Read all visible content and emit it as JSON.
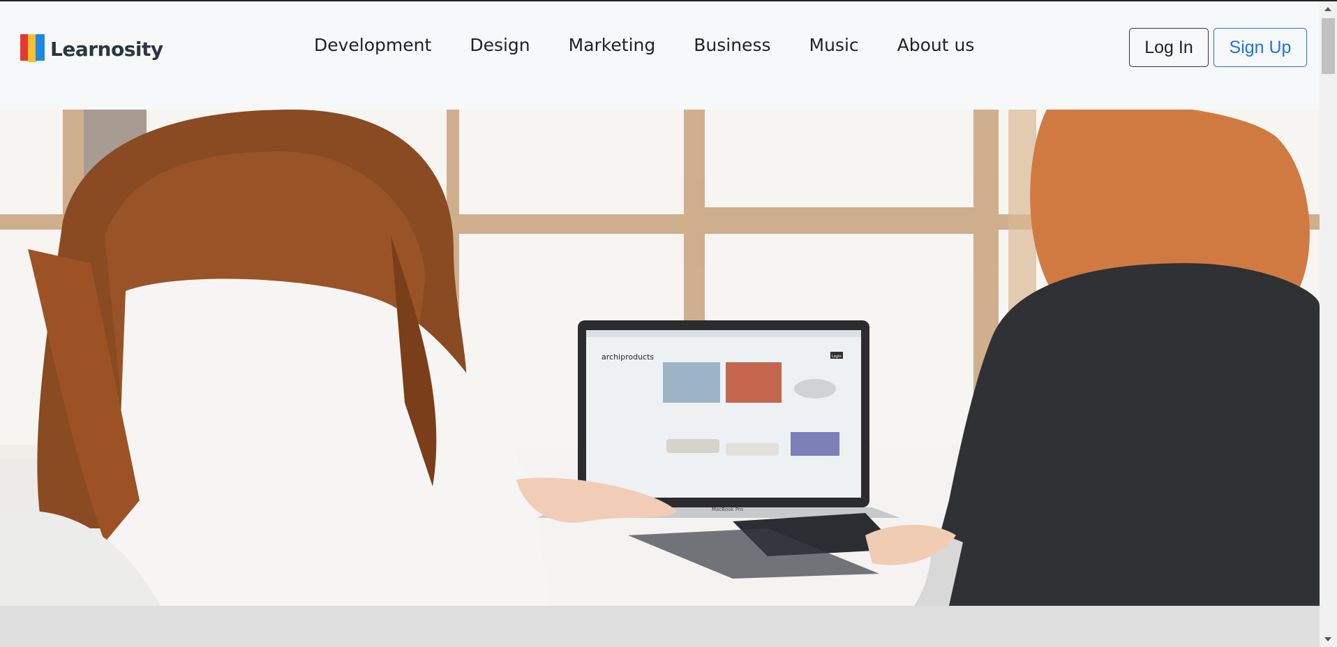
{
  "brand": {
    "name": "Learnosity",
    "colors": [
      "#e53935",
      "#fbc02d",
      "#1e88e5"
    ]
  },
  "nav": {
    "links": [
      "Development",
      "Design",
      "Marketing",
      "Business",
      "Music",
      "About us"
    ]
  },
  "auth": {
    "login_label": "Log In",
    "signup_label": "Sign Up",
    "signup_color": "#1a73e8"
  },
  "hero": {
    "icon": "hero-photo",
    "laptop_screen_title": "archiproducts",
    "laptop_screen_button": "Login",
    "laptop_brand": "MacBook Pro"
  }
}
